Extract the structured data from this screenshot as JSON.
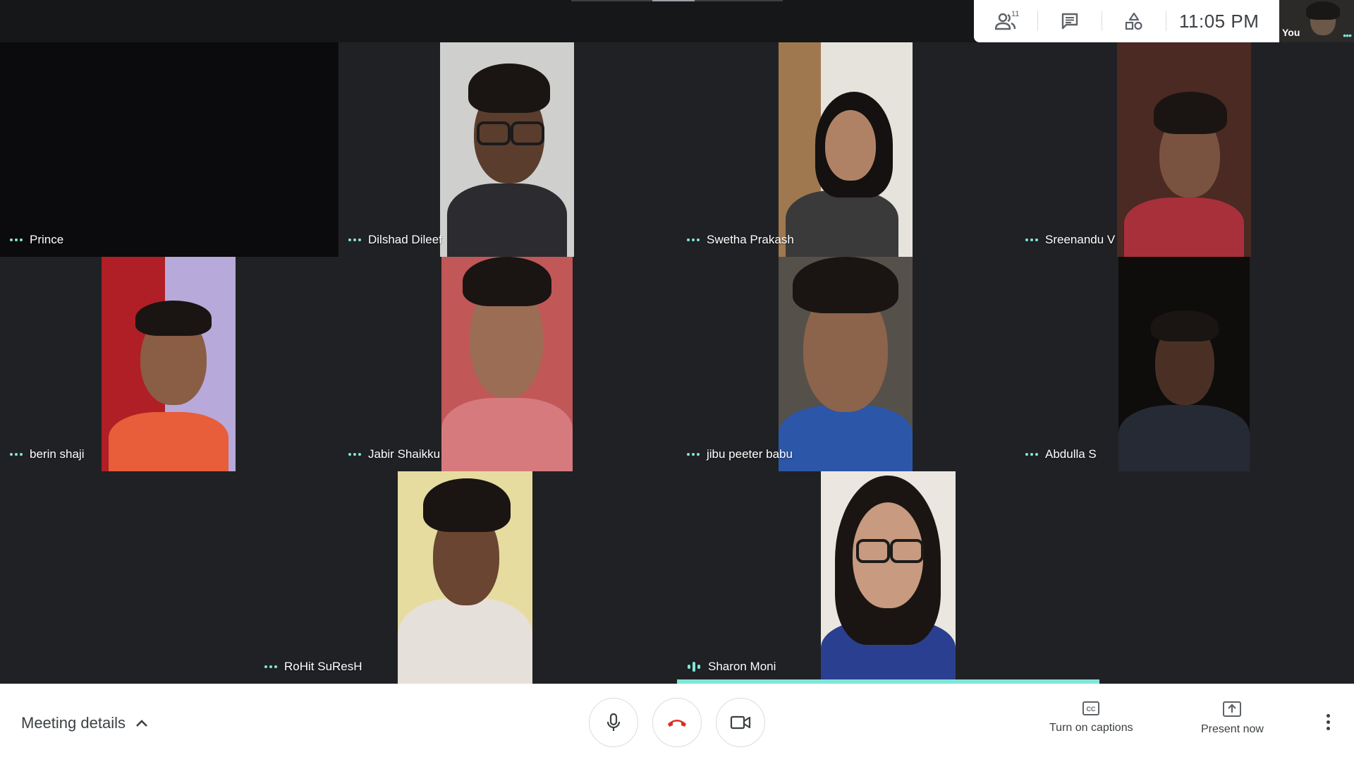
{
  "topbar": {
    "people_count": "11",
    "time": "11:05 PM",
    "self_label": "You",
    "icons": [
      "people-icon",
      "chat-icon",
      "activities-icon"
    ]
  },
  "participants": [
    {
      "name": "Prince",
      "status": "dots"
    },
    {
      "name": "Dilshad Dileef",
      "status": "dots"
    },
    {
      "name": "Swetha Prakash",
      "status": "dots"
    },
    {
      "name": "Sreenandu V",
      "status": "dots"
    },
    {
      "name": "berin shaji",
      "status": "dots"
    },
    {
      "name": "Jabir Shaikku",
      "status": "dots"
    },
    {
      "name": "jibu peeter babu",
      "status": "dots"
    },
    {
      "name": "Abdulla S",
      "status": "dots"
    },
    {
      "name": "RoHit SuResH",
      "status": "dots"
    },
    {
      "name": "Sharon Moni",
      "status": "speaking"
    }
  ],
  "bottombar": {
    "meeting_details": "Meeting details",
    "captions_label": "Turn on captions",
    "present_label": "Present now"
  },
  "colors": {
    "accent": "#81e6d9",
    "hangup": "#d93025",
    "grid_bg": "#202124"
  }
}
